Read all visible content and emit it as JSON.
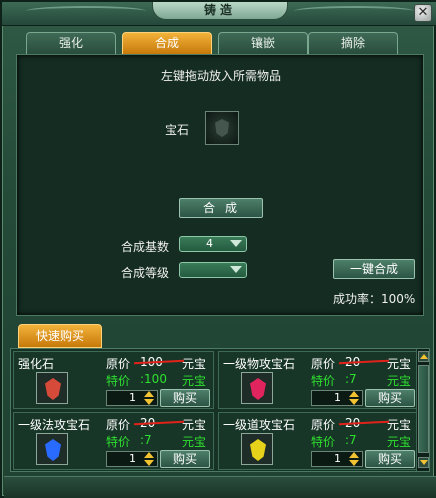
{
  "window": {
    "title": "铸造",
    "close_label": "✕"
  },
  "tabs": [
    {
      "label": "强化",
      "active": false
    },
    {
      "label": "合成",
      "active": true
    },
    {
      "label": "镶嵌",
      "active": false
    },
    {
      "label": "摘除",
      "active": false
    }
  ],
  "synthesis": {
    "hint": "左键拖动放入所需物品",
    "gem_label": "宝石",
    "combine_button": "合成",
    "base_count_label": "合成基数",
    "base_count_value": "4",
    "level_label": "合成等级",
    "level_value": "",
    "onekey_button": "一键合成",
    "success_rate": "成功率：100%"
  },
  "quick_buy": {
    "tab_label": "快速购买",
    "price_label": "原价",
    "sale_label": "特价",
    "currency": "元宝",
    "buy_label": "购买",
    "items": [
      {
        "name": "强化石",
        "orig_price": "100",
        "sale_price": ":100",
        "qty": "1",
        "gem_color": "#d64a3a"
      },
      {
        "name": "一级物攻宝石",
        "orig_price": "20",
        "sale_price": ":7",
        "qty": "1",
        "gem_color": "#e0245e"
      },
      {
        "name": "一级法攻宝石",
        "orig_price": "20",
        "sale_price": ":7",
        "qty": "1",
        "gem_color": "#2a6bff"
      },
      {
        "name": "一级道攻宝石",
        "orig_price": "20",
        "sale_price": ":7",
        "qty": "1",
        "gem_color": "#e6d21a"
      }
    ]
  },
  "colors": {
    "accent_tab": "#f2b23a",
    "sale_green": "#2ee02e",
    "strike_red": "#e0221a"
  }
}
